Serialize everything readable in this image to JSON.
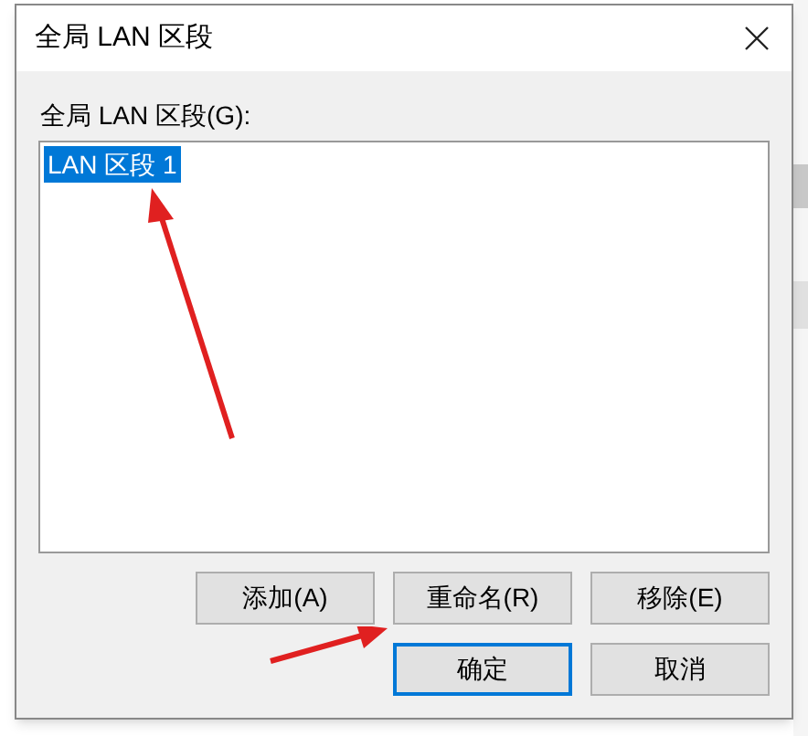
{
  "dialog": {
    "title": "全局 LAN 区段",
    "list_label": "全局 LAN 区段(G):",
    "list_items": [
      {
        "label": "LAN 区段 1",
        "selected": true
      }
    ],
    "action_buttons": [
      {
        "label": "添加(A)"
      },
      {
        "label": "重命名(R)"
      },
      {
        "label": "移除(E)"
      }
    ],
    "footer_buttons": [
      {
        "label": "确定",
        "selected": true
      },
      {
        "label": "取消",
        "selected": false
      }
    ]
  }
}
